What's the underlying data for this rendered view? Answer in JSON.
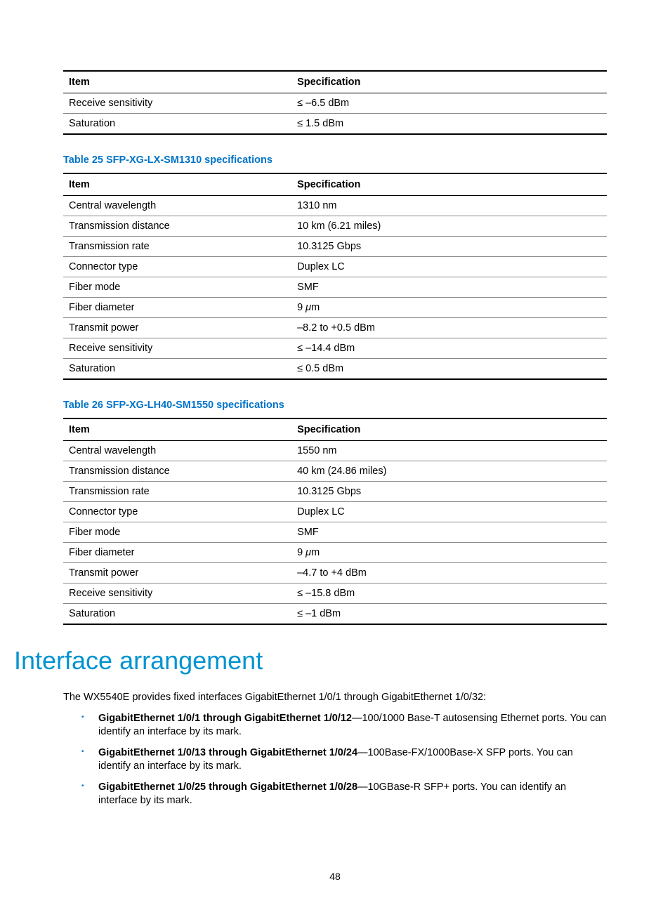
{
  "headers": {
    "item": "Item",
    "spec": "Specification"
  },
  "table24": {
    "rows": [
      {
        "item": "Receive sensitivity",
        "spec": "≤ –6.5 dBm"
      },
      {
        "item": "Saturation",
        "spec": "≤ 1.5 dBm"
      }
    ]
  },
  "table25": {
    "caption": "Table 25 SFP-XG-LX-SM1310 specifications",
    "rows": [
      {
        "item": "Central wavelength",
        "spec": "1310 nm"
      },
      {
        "item": "Transmission distance",
        "spec": "10 km (6.21 miles)"
      },
      {
        "item": "Transmission rate",
        "spec": "10.3125 Gbps"
      },
      {
        "item": "Connector type",
        "spec": "Duplex LC"
      },
      {
        "item": "Fiber mode",
        "spec": "SMF"
      },
      {
        "item": "Fiber diameter",
        "spec": "9 μm"
      },
      {
        "item": "Transmit power",
        "spec": "–8.2 to +0.5 dBm"
      },
      {
        "item": "Receive sensitivity",
        "spec": "≤ –14.4 dBm"
      },
      {
        "item": "Saturation",
        "spec": "≤ 0.5 dBm"
      }
    ]
  },
  "table26": {
    "caption": "Table 26 SFP-XG-LH40-SM1550 specifications",
    "rows": [
      {
        "item": "Central wavelength",
        "spec": "1550 nm"
      },
      {
        "item": "Transmission distance",
        "spec": "40 km (24.86 miles)"
      },
      {
        "item": "Transmission rate",
        "spec": "10.3125 Gbps"
      },
      {
        "item": "Connector type",
        "spec": "Duplex LC"
      },
      {
        "item": "Fiber mode",
        "spec": "SMF"
      },
      {
        "item": "Fiber diameter",
        "spec": "9 μm"
      },
      {
        "item": "Transmit power",
        "spec": "–4.7 to +4 dBm"
      },
      {
        "item": "Receive sensitivity",
        "spec": "≤ –15.8 dBm"
      },
      {
        "item": "Saturation",
        "spec": "≤ –1 dBm"
      }
    ]
  },
  "section": {
    "title": "Interface arrangement",
    "intro": "The WX5540E provides fixed interfaces GigabitEthernet 1/0/1 through GigabitEthernet 1/0/32:",
    "bullets": [
      {
        "bold": "GigabitEthernet 1/0/1 through GigabitEthernet 1/0/12",
        "rest": "—100/1000 Base-T autosensing Ethernet ports. You can identify an interface by its mark."
      },
      {
        "bold": "GigabitEthernet 1/0/13 through GigabitEthernet 1/0/24",
        "rest": "—100Base-FX/1000Base-X SFP ports. You can identify an interface by its mark."
      },
      {
        "bold": "GigabitEthernet 1/0/25 through GigabitEthernet 1/0/28",
        "rest": "—10GBase-R SFP+ ports. You can identify an interface by its mark."
      }
    ]
  },
  "page_number": "48"
}
